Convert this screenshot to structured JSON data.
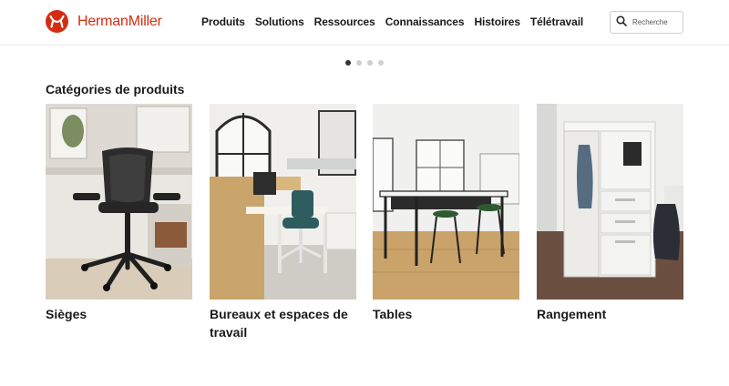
{
  "brand": {
    "name": "HermanMiller",
    "color": "#d42d11"
  },
  "nav": {
    "items": [
      "Produits",
      "Solutions",
      "Ressources",
      "Connaissances",
      "Histoires",
      "Télétravail"
    ]
  },
  "search": {
    "placeholder": "Recherche",
    "icon": "search-icon"
  },
  "carousel": {
    "dot_count": 4,
    "active_index": 0
  },
  "categories": {
    "title": "Catégories de produits",
    "items": [
      {
        "label": "Sièges",
        "image": "office-chair-photo"
      },
      {
        "label": "Bureaux et espaces de travail",
        "image": "desk-workspace-photo"
      },
      {
        "label": "Tables",
        "image": "high-table-stools-photo"
      },
      {
        "label": "Rangement",
        "image": "storage-locker-photo"
      }
    ]
  }
}
